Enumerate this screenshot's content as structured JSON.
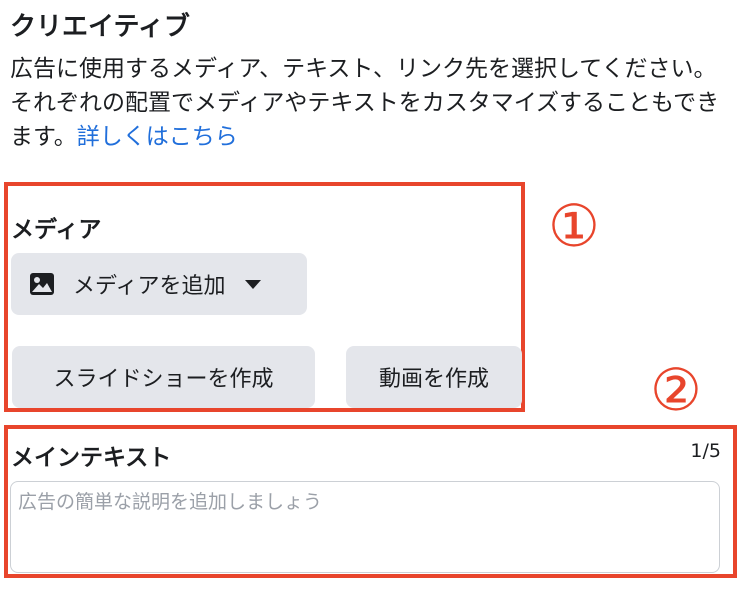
{
  "header": {
    "title": "クリエイティブ",
    "description": "広告に使用するメディア、テキスト、リンク先を選択してください。それぞれの配置でメディアやテキストをカスタマイズすることもできます。",
    "learn_more": "詳しくはこちら"
  },
  "annotations": {
    "one": "①",
    "two": "②",
    "color": "#e8452c"
  },
  "media": {
    "label": "メディア",
    "add_button": "メディアを追加",
    "add_icon": "image-icon",
    "dropdown_icon": "caret-down-icon",
    "slideshow_button": "スライドショーを作成",
    "video_button": "動画を作成"
  },
  "main_text": {
    "label": "メインテキスト",
    "counter": "1/5",
    "placeholder": "広告の簡単な説明を追加しましょう",
    "value": ""
  },
  "colors": {
    "link": "#216fdb",
    "button_bg": "#e4e6eb",
    "text": "#1c1e21"
  }
}
